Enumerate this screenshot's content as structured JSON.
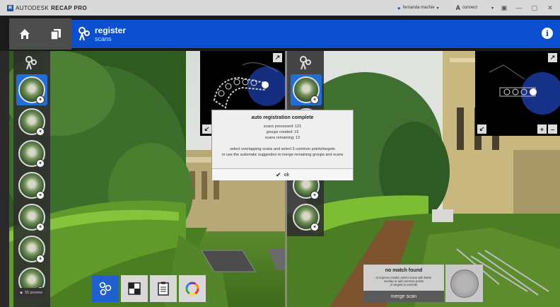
{
  "app": {
    "logo_letter": "R",
    "brand": "AUTODESK",
    "product": "RECAP PRO"
  },
  "titlebar": {
    "user_name": "fernanda machie",
    "connect_label": "connect",
    "minimize": "—",
    "restore": "▢",
    "close": "✕"
  },
  "header": {
    "title": "register",
    "subtitle": "scans",
    "info_label": "i"
  },
  "dialog": {
    "title": "auto registration complete",
    "scans_processed": "scans processed: 121",
    "groups_created": "groups created: 15",
    "scans_remaining": "scans remaining: 13",
    "instruction_line1": "select overlapping scans and select 3 common points/targets",
    "instruction_line2": "or use the automatic suggestion to merge remaining groups and scans",
    "ok_label": "ok"
  },
  "no_match": {
    "title": "no match found",
    "desc_line1": "to improve results, select scans with better",
    "desc_line2": "overlap or add common points",
    "desc_line3": "or targets to override"
  },
  "merge_button": {
    "label": "merge scan"
  },
  "cube_label": "3D preview",
  "colors": {
    "accent": "#0b4fd0",
    "selection": "#1f6fd6",
    "panel": "#4d4d4d"
  },
  "icons": [
    "home-icon",
    "copy-icon",
    "register-scans-icon",
    "info-icon",
    "expand-icon",
    "collapse-icon",
    "zoom-in-icon",
    "zoom-out-icon",
    "group-icon",
    "checkerboard-icon",
    "clipboard-icon",
    "color-wheel-icon",
    "checkmark-icon",
    "cube-icon"
  ]
}
